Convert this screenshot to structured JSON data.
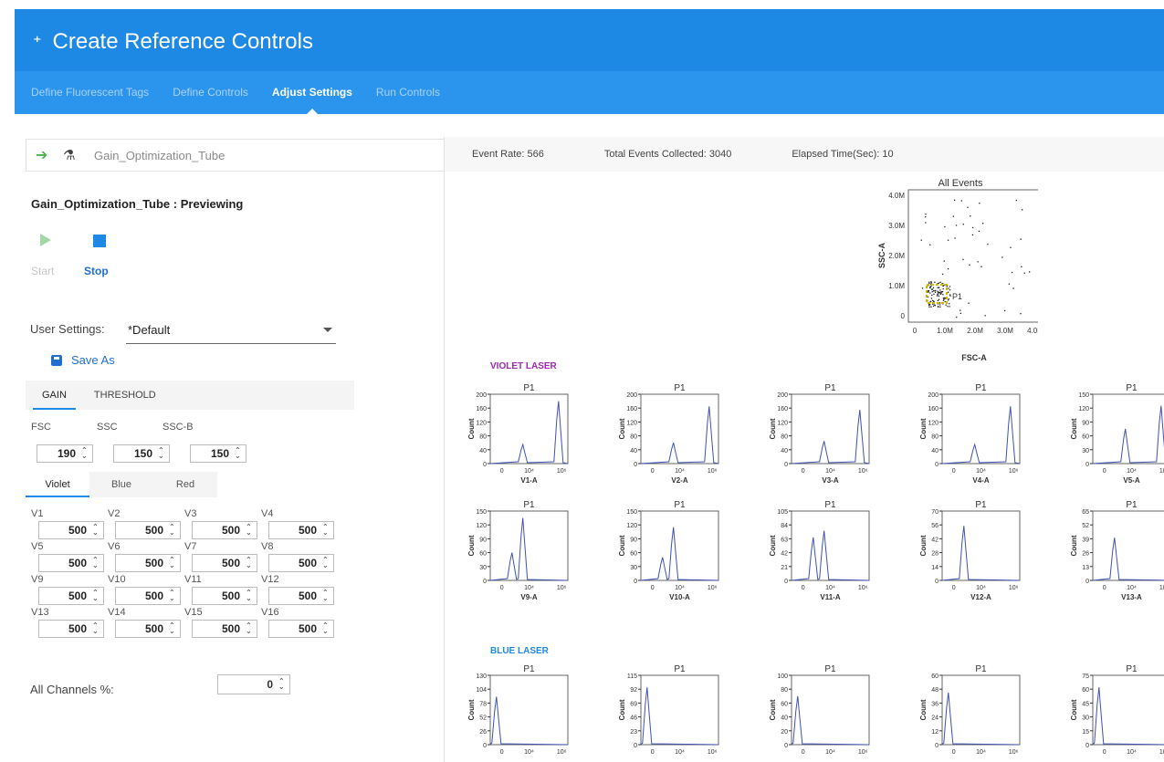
{
  "header": {
    "title": "Create Reference Controls",
    "tabs": [
      {
        "label": "Define Fluorescent Tags",
        "active": false
      },
      {
        "label": "Define Controls",
        "active": false
      },
      {
        "label": "Adjust Settings",
        "active": true
      },
      {
        "label": "Run Controls",
        "active": false
      }
    ]
  },
  "left_panel": {
    "tube_name": "Gain_Optimization_Tube",
    "preview_title": "Gain_Optimization_Tube : Previewing",
    "start_label": "Start",
    "stop_label": "Stop",
    "user_settings_label": "User Settings:",
    "user_settings_value": "*Default",
    "save_as_label": "Save As",
    "gain_tabs": [
      "GAIN",
      "THRESHOLD"
    ],
    "scatter": [
      {
        "label": "FSC",
        "value": "190"
      },
      {
        "label": "SSC",
        "value": "150"
      },
      {
        "label": "SSC-B",
        "value": "150"
      }
    ],
    "laser_tabs": [
      "Violet",
      "Blue",
      "Red"
    ],
    "violet_channels": [
      {
        "label": "V1",
        "value": "500"
      },
      {
        "label": "V2",
        "value": "500"
      },
      {
        "label": "V3",
        "value": "500"
      },
      {
        "label": "V4",
        "value": "500"
      },
      {
        "label": "V5",
        "value": "500"
      },
      {
        "label": "V6",
        "value": "500"
      },
      {
        "label": "V7",
        "value": "500"
      },
      {
        "label": "V8",
        "value": "500"
      },
      {
        "label": "V9",
        "value": "500"
      },
      {
        "label": "V10",
        "value": "500"
      },
      {
        "label": "V11",
        "value": "500"
      },
      {
        "label": "V12",
        "value": "500"
      },
      {
        "label": "V13",
        "value": "500"
      },
      {
        "label": "V14",
        "value": "500"
      },
      {
        "label": "V15",
        "value": "500"
      },
      {
        "label": "V16",
        "value": "500"
      }
    ],
    "all_channels_label": "All Channels %:",
    "all_channels_value": "0"
  },
  "right_panel": {
    "event_rate": "Event Rate: 566",
    "total_events": "Total Events Collected: 3040",
    "elapsed": "Elapsed Time(Sec): 10",
    "scatter_plot": {
      "title": "All Events",
      "xlabel": "FSC-A",
      "ylabel": "SSC-A",
      "ticks": [
        "0",
        "1.0M",
        "2.0M",
        "3.0M",
        "4.0M"
      ],
      "gate_label": "P1"
    },
    "violet_label": "VIOLET LASER",
    "blue_label": "BLUE LASER",
    "violet_color": "#9c27b0",
    "blue_color": "#1e88e5",
    "histogram_title": "P1",
    "histogram_ylabel": "Count",
    "x_tick_labels": [
      "0",
      "10⁴",
      "10⁶"
    ]
  },
  "chart_data": [
    {
      "type": "histogram",
      "title": "P1",
      "xlabel": "V1-A",
      "ylabel": "Count",
      "yticks": [
        0,
        40,
        80,
        120,
        160,
        200
      ],
      "peaks": [
        {
          "x": "10^4",
          "height": 55
        },
        {
          "x": "10^6",
          "height": 180
        }
      ]
    },
    {
      "type": "histogram",
      "title": "P1",
      "xlabel": "V2-A",
      "ylabel": "Count",
      "yticks": [
        0,
        40,
        80,
        120,
        160,
        200
      ],
      "peaks": [
        {
          "x": "10^4",
          "height": 60
        },
        {
          "x": "10^6",
          "height": 165
        }
      ]
    },
    {
      "type": "histogram",
      "title": "P1",
      "xlabel": "V3-A",
      "ylabel": "Count",
      "yticks": [
        0,
        40,
        80,
        120,
        160,
        200
      ],
      "peaks": [
        {
          "x": "10^4",
          "height": 65
        },
        {
          "x": "10^6",
          "height": 155
        }
      ]
    },
    {
      "type": "histogram",
      "title": "P1",
      "xlabel": "V4-A",
      "ylabel": "Count",
      "yticks": [
        0,
        40,
        80,
        120,
        160,
        200
      ],
      "peaks": [
        {
          "x": "10^4",
          "height": 55
        },
        {
          "x": "10^6",
          "height": 165
        }
      ]
    },
    {
      "type": "histogram",
      "title": "P1",
      "xlabel": "V5-A",
      "ylabel": "Count",
      "yticks": [
        0,
        30,
        60,
        90,
        120,
        150
      ],
      "peaks": [
        {
          "x": "10^4",
          "height": 75
        },
        {
          "x": "10^6",
          "height": 125
        }
      ]
    },
    {
      "type": "histogram",
      "title": "P1",
      "xlabel": "V9-A",
      "ylabel": "Count",
      "yticks": [
        0,
        30,
        60,
        90,
        120,
        150
      ],
      "peaks": [
        {
          "x": "10^3",
          "height": 60
        },
        {
          "x": "10^4",
          "height": 135
        }
      ]
    },
    {
      "type": "histogram",
      "title": "P1",
      "xlabel": "V10-A",
      "ylabel": "Count",
      "yticks": [
        0,
        30,
        60,
        90,
        120,
        150
      ],
      "peaks": [
        {
          "x": "10^3",
          "height": 50
        },
        {
          "x": "10^4",
          "height": 115
        }
      ]
    },
    {
      "type": "histogram",
      "title": "P1",
      "xlabel": "V11-A",
      "ylabel": "Count",
      "yticks": [
        0,
        21,
        42,
        63,
        84,
        105
      ],
      "peaks": [
        {
          "x": "10^3",
          "height": 65
        },
        {
          "x": "10^4",
          "height": 75
        }
      ]
    },
    {
      "type": "histogram",
      "title": "P1",
      "xlabel": "V12-A",
      "ylabel": "Count",
      "yticks": [
        0,
        14,
        28,
        42,
        56,
        70
      ],
      "peaks": [
        {
          "x": "10^3",
          "height": 55
        }
      ]
    },
    {
      "type": "histogram",
      "title": "P1",
      "xlabel": "V13-A",
      "ylabel": "Count",
      "yticks": [
        0,
        13,
        26,
        39,
        52,
        65
      ],
      "peaks": [
        {
          "x": "10^3",
          "height": 40
        }
      ]
    },
    {
      "type": "histogram",
      "title": "P1",
      "xlabel": "",
      "ylabel": "Count",
      "yticks": [
        0,
        26,
        52,
        78,
        104,
        130
      ],
      "peaks": [
        {
          "x": "0",
          "height": 90
        }
      ]
    },
    {
      "type": "histogram",
      "title": "P1",
      "xlabel": "",
      "ylabel": "Count",
      "yticks": [
        0,
        23,
        46,
        69,
        92,
        115
      ],
      "peaks": [
        {
          "x": "0",
          "height": 95
        }
      ]
    },
    {
      "type": "histogram",
      "title": "P1",
      "xlabel": "",
      "ylabel": "Count",
      "yticks": [
        0,
        20,
        40,
        60,
        80,
        100
      ],
      "peaks": [
        {
          "x": "0",
          "height": 70
        }
      ]
    },
    {
      "type": "histogram",
      "title": "P1",
      "xlabel": "",
      "ylabel": "Count",
      "yticks": [
        0,
        12,
        24,
        36,
        48,
        60
      ],
      "peaks": [
        {
          "x": "0",
          "height": 45
        }
      ]
    },
    {
      "type": "histogram",
      "title": "P1",
      "xlabel": "",
      "ylabel": "Count",
      "yticks": [
        0,
        15,
        30,
        45,
        60,
        75
      ],
      "peaks": [
        {
          "x": "0",
          "height": 62
        }
      ]
    }
  ]
}
